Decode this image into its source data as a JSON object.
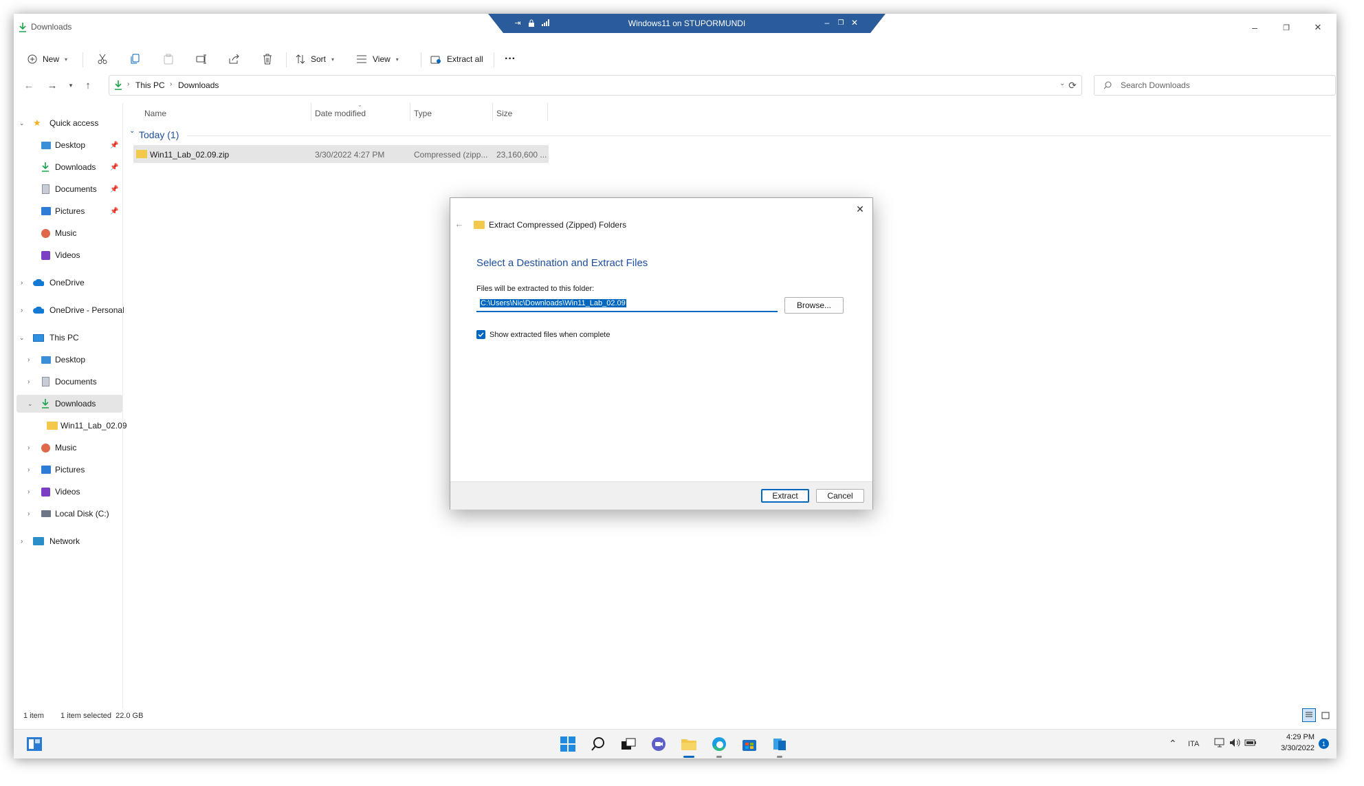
{
  "window": {
    "title": "Downloads",
    "rdp_title": "Windows11 on STUPORMUNDI"
  },
  "toolbar": {
    "new_label": "New",
    "sort_label": "Sort",
    "view_label": "View",
    "extract_all_label": "Extract all",
    "more_label": "···"
  },
  "address": {
    "crumbs": [
      "This PC",
      "Downloads"
    ],
    "search_placeholder": "Search Downloads"
  },
  "nav": {
    "items": [
      {
        "label": "Quick access",
        "icon": "star-icon"
      },
      {
        "label": "Desktop",
        "icon": "desktop-icon",
        "pinned": true
      },
      {
        "label": "Downloads",
        "icon": "download-icon",
        "pinned": true
      },
      {
        "label": "Documents",
        "icon": "document-icon",
        "pinned": true
      },
      {
        "label": "Pictures",
        "icon": "pictures-icon",
        "pinned": true
      },
      {
        "label": "Music",
        "icon": "music-icon"
      },
      {
        "label": "Videos",
        "icon": "videos-icon"
      },
      {
        "label": "OneDrive",
        "icon": "cloud-icon"
      },
      {
        "label": "OneDrive - Personal",
        "icon": "cloud-icon"
      },
      {
        "label": "This PC",
        "icon": "computer-icon"
      },
      {
        "label": "Desktop",
        "icon": "desktop-icon"
      },
      {
        "label": "Documents",
        "icon": "document-icon"
      },
      {
        "label": "Downloads",
        "icon": "download-icon"
      },
      {
        "label": "Win11_Lab_02.09",
        "icon": "folder-icon"
      },
      {
        "label": "Music",
        "icon": "music-icon"
      },
      {
        "label": "Pictures",
        "icon": "pictures-icon"
      },
      {
        "label": "Videos",
        "icon": "videos-icon"
      },
      {
        "label": "Local Disk (C:)",
        "icon": "drive-icon"
      },
      {
        "label": "Network",
        "icon": "network-icon"
      }
    ]
  },
  "filelist": {
    "columns": [
      "Name",
      "Date modified",
      "Type",
      "Size"
    ],
    "group_label": "Today (1)",
    "rows": [
      {
        "name": "Win11_Lab_02.09.zip",
        "date": "3/30/2022 4:27 PM",
        "type": "Compressed (zipp...",
        "size": "23,160,600 ..."
      }
    ]
  },
  "dialog": {
    "title": "Extract Compressed (Zipped) Folders",
    "heading": "Select a Destination and Extract Files",
    "path_label": "Files will be extracted to this folder:",
    "path_value": "C:\\Users\\Nic\\Downloads\\Win11_Lab_02.09",
    "browse_label": "Browse...",
    "checkbox_label": "Show extracted files when complete",
    "checkbox_checked": true,
    "extract_label": "Extract",
    "cancel_label": "Cancel"
  },
  "status": {
    "item_count": "1 item",
    "selection": "1 item selected  22.0 GB"
  },
  "taskbar": {
    "language": "ITA",
    "time": "4:29 PM",
    "date": "3/30/2022",
    "notification_count": "1"
  },
  "colors": {
    "accent": "#0067c0",
    "heading_blue": "#1e4ea0",
    "folder_yellow": "#f2c94c",
    "rdp_bar": "#2a5b9a",
    "selection_bg": "#e5e5e5"
  }
}
